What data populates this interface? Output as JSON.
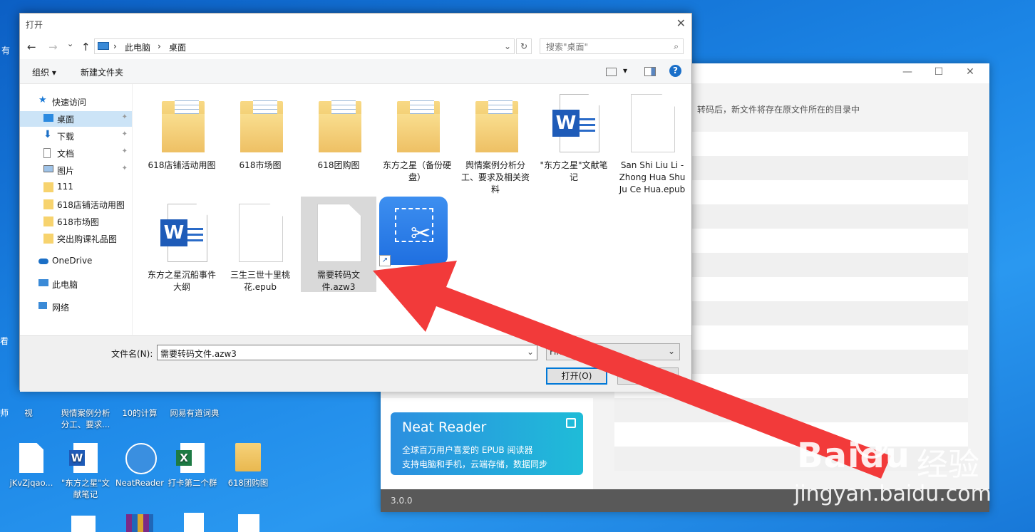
{
  "desktop": {
    "row1": [
      {
        "label": "视",
        "kind": "doc"
      },
      {
        "label": "舆情案例分析分工、要求...",
        "kind": "folder"
      },
      {
        "label": "10的计算",
        "kind": "image"
      },
      {
        "label": "网易有道词典",
        "kind": "app"
      }
    ],
    "row2": [
      {
        "label": "jKvZjqao...",
        "kind": "doc"
      },
      {
        "label": "\"东方之星\"文献笔记",
        "kind": "word"
      },
      {
        "label": "NeatReader",
        "kind": "reader"
      },
      {
        "label": "打卡第二个群",
        "kind": "excel"
      },
      {
        "label": "618团购图",
        "kind": "folder"
      }
    ],
    "edge_labels": {
      "left1": "有",
      "left2": "师",
      "left3": "看"
    }
  },
  "converter": {
    "hint": "转码后，新文件将存在原文件所在的目录中",
    "neat_reader": {
      "title": "Neat Reader",
      "line1": "全球百万用户喜爱的 EPUB 阅读器",
      "line2": "支持电脑和手机，云端存储，数据同步"
    },
    "version": "3.0.0",
    "window_controls": {
      "minimize": "—",
      "maximize": "☐",
      "close": "✕"
    }
  },
  "dialog": {
    "title": "打开",
    "close": "✕",
    "nav": {
      "back": "←",
      "forward": "→",
      "recent": "⌄",
      "up": "↑"
    },
    "breadcrumb": [
      "此电脑",
      "桌面"
    ],
    "breadcrumb_sep": "›",
    "search_placeholder": "搜索\"桌面\"",
    "toolbar": {
      "organize": "组织 ▾",
      "new_folder": "新建文件夹",
      "help": "?"
    },
    "sidebar": {
      "quick_access": "快速访问",
      "items": [
        {
          "label": "桌面",
          "icon": "desktop-icon",
          "pinned": true,
          "selected": true
        },
        {
          "label": "下载",
          "icon": "download-icon",
          "pinned": true
        },
        {
          "label": "文档",
          "icon": "document-icon",
          "pinned": true
        },
        {
          "label": "图片",
          "icon": "picture-icon",
          "pinned": true
        },
        {
          "label": "111",
          "icon": "folder-icon"
        },
        {
          "label": "618店铺活动用图",
          "icon": "folder-icon"
        },
        {
          "label": "618市场图",
          "icon": "folder-icon"
        },
        {
          "label": "突出购课礼品图",
          "icon": "folder-icon"
        }
      ],
      "onedrive": "OneDrive",
      "this_pc": "此电脑",
      "network": "网络"
    },
    "files": [
      {
        "name": "618店铺活动用图",
        "type": "folder"
      },
      {
        "name": "618市场图",
        "type": "folder"
      },
      {
        "name": "618团购图",
        "type": "folder"
      },
      {
        "name": "东方之星（备份硬盘）",
        "type": "folder"
      },
      {
        "name": "舆情案例分析分工、要求及相关资料",
        "type": "folder"
      },
      {
        "name": "\"东方之星\"文献笔记",
        "type": "word"
      },
      {
        "name": "San Shi Liu Li - Zhong Hua Shu Ju Ce Hua.epub",
        "type": "file"
      },
      {
        "name": "东方之星沉船事件大纲",
        "type": "word"
      },
      {
        "name": "三生三世十里桃花.epub",
        "type": "file"
      },
      {
        "name": "需要转码文件.azw3",
        "type": "file",
        "selected": true
      },
      {
        "name": "",
        "type": "app-shortcut"
      }
    ],
    "filename_label": "文件名(N):",
    "filename_value": "需要转码文件.azw3",
    "filetype_value": "File",
    "open_button": "打开(O)",
    "cancel_button": "取消"
  },
  "watermark": {
    "brand": "Bai",
    "brand2": "du",
    "tail": "经验",
    "url": "jingyan.baidu.com"
  },
  "colors": {
    "arrow": "#f23a3a",
    "accent": "#0078d7",
    "desktop": "#1c86e6"
  }
}
